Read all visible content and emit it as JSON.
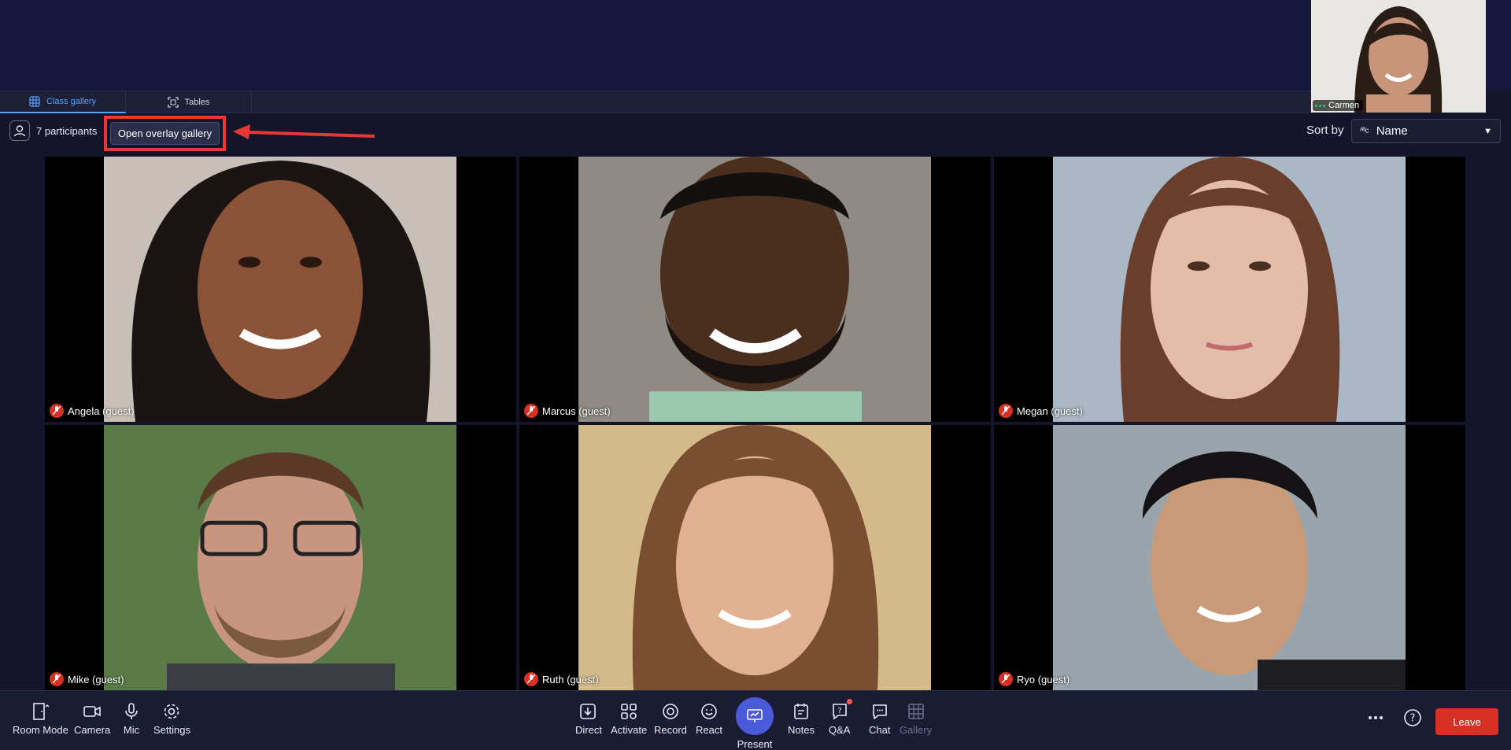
{
  "self_view": {
    "name": "Carmen"
  },
  "tabs": [
    {
      "label": "Class gallery",
      "icon": "grid-icon",
      "active": true
    },
    {
      "label": "Tables",
      "icon": "expand-icon",
      "active": false
    }
  ],
  "participants": {
    "label": "7 participants"
  },
  "overlay_button": {
    "label": "Open overlay gallery"
  },
  "sort": {
    "label": "Sort by",
    "value": "Name"
  },
  "tiles": [
    {
      "name": "Angela (guest)",
      "muted": true
    },
    {
      "name": "Marcus (guest)",
      "muted": true
    },
    {
      "name": "Megan (guest)",
      "muted": true
    },
    {
      "name": "Mike (guest)",
      "muted": true
    },
    {
      "name": "Ruth (guest)",
      "muted": true
    },
    {
      "name": "Ryo (guest)",
      "muted": true
    }
  ],
  "controls": {
    "room_mode": "Room Mode",
    "camera": "Camera",
    "mic": "Mic",
    "settings": "Settings",
    "direct": "Direct",
    "activate": "Activate",
    "record": "Record",
    "react": "React",
    "present": "Present",
    "notes": "Notes",
    "qa": "Q&A",
    "chat": "Chat",
    "gallery": "Gallery",
    "leave": "Leave"
  },
  "colors": {
    "accent": "#5aa0ff",
    "leave": "#d93025",
    "present": "#4a5ad8",
    "highlight": "#e53935"
  }
}
